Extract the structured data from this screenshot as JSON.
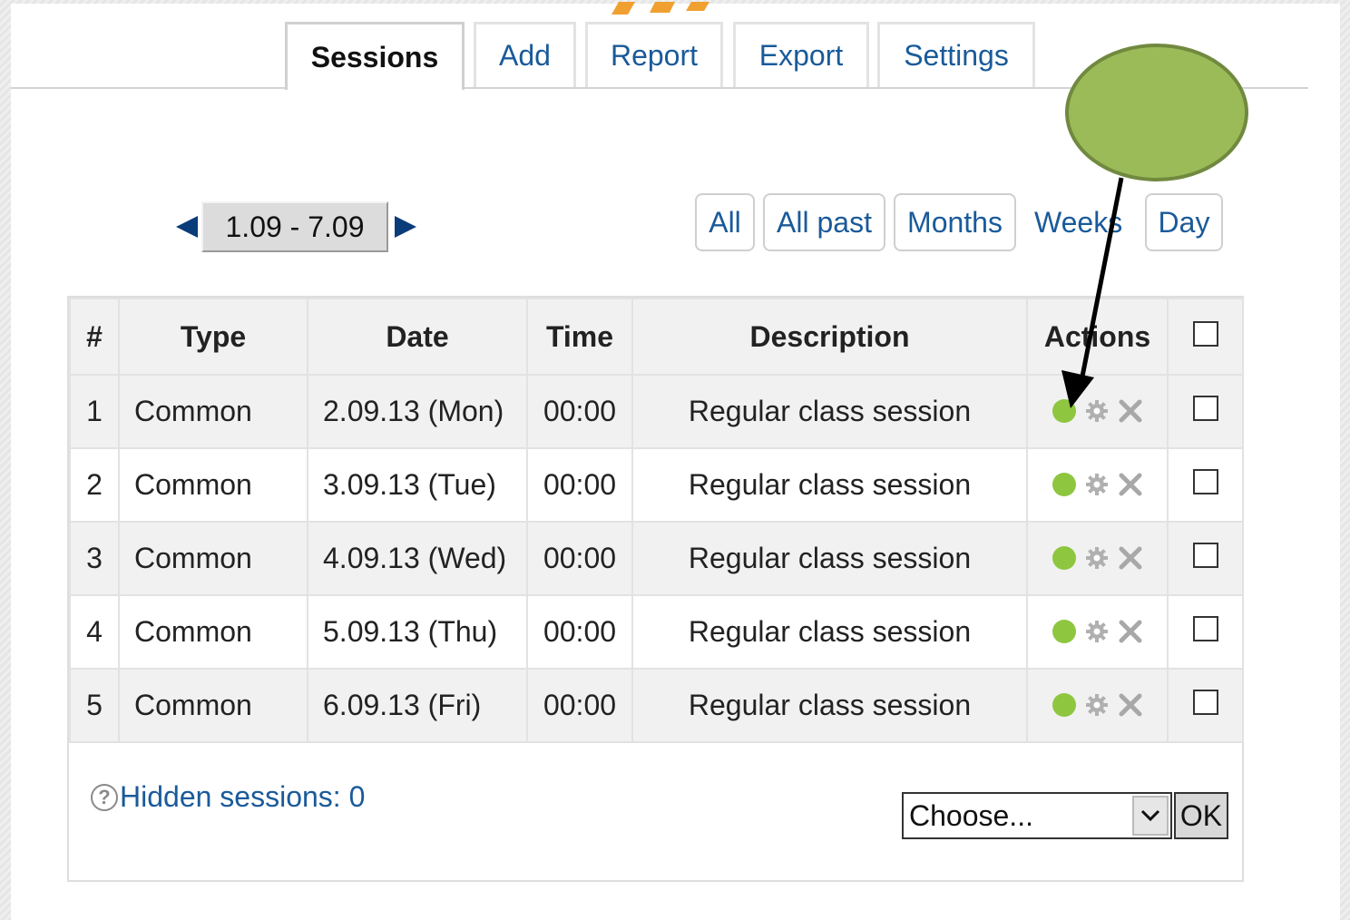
{
  "tabs": [
    {
      "label": "Sessions",
      "active": true
    },
    {
      "label": "Add",
      "active": false
    },
    {
      "label": "Report",
      "active": false
    },
    {
      "label": "Export",
      "active": false
    },
    {
      "label": "Settings",
      "active": false
    }
  ],
  "pager": {
    "week_label": "1.09 - 7.09",
    "prev_icon": "triangle-left-icon",
    "next_icon": "triangle-right-icon"
  },
  "views": {
    "all": "All",
    "all_past": "All past",
    "months": "Months",
    "weeks": "Weeks",
    "day": "Day"
  },
  "table": {
    "headers": {
      "num": "#",
      "type": "Type",
      "date": "Date",
      "time": "Time",
      "description": "Description",
      "actions": "Actions"
    },
    "rows": [
      {
        "num": "1",
        "type": "Common",
        "date": "2.09.13 (Mon)",
        "time": "00:00",
        "description": "Regular class session"
      },
      {
        "num": "2",
        "type": "Common",
        "date": "3.09.13 (Tue)",
        "time": "00:00",
        "description": "Regular class session"
      },
      {
        "num": "3",
        "type": "Common",
        "date": "4.09.13 (Wed)",
        "time": "00:00",
        "description": "Regular class session"
      },
      {
        "num": "4",
        "type": "Common",
        "date": "5.09.13 (Thu)",
        "time": "00:00",
        "description": "Regular class session"
      },
      {
        "num": "5",
        "type": "Common",
        "date": "6.09.13 (Fri)",
        "time": "00:00",
        "description": "Regular class session"
      }
    ]
  },
  "footer": {
    "hidden_sessions": "Hidden sessions: 0",
    "select_value": "Choose...",
    "ok_label": "OK"
  },
  "colors": {
    "link": "#1a5a9a",
    "status_dot": "#8ec63f",
    "annotation_fill": "#9bbb59",
    "annotation_border": "#71893f"
  }
}
